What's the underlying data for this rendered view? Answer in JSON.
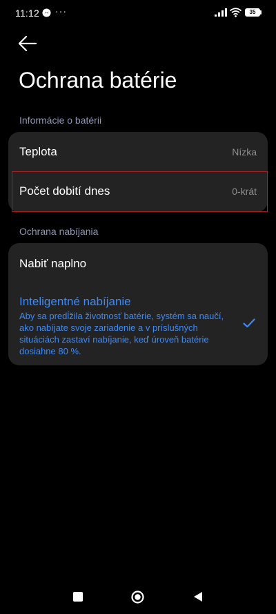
{
  "status_bar": {
    "time": "11:12",
    "more_indicator": "···",
    "battery_level": "35",
    "icons": [
      "messenger-icon",
      "signal-icon",
      "wifi-icon",
      "battery-icon"
    ]
  },
  "header": {
    "back_icon": "arrow-left-icon",
    "title": "Ochrana batérie"
  },
  "battery_info": {
    "section_title": "Informácie o batérii",
    "rows": [
      {
        "label": "Teplota",
        "value": "Nízka"
      },
      {
        "label": "Počet dobití dnes",
        "value": "0-krát"
      }
    ]
  },
  "charging_protection": {
    "section_title": "Ochrana nabíjania",
    "options": [
      {
        "label": "Nabiť naplno",
        "selected": false
      },
      {
        "label": "Inteligentné nabíjanie",
        "description": "Aby sa predĺžila životnosť batérie, systém sa naučí, ako nabíjate svoje zariadenie a v príslušných situáciách zastaví nabíjanie, keď úroveň batérie dosiahne 80 %.",
        "selected": true
      }
    ]
  },
  "colors": {
    "background": "#000000",
    "card": "#232323",
    "accent": "#3d8af7",
    "section_header": "#8e97b5",
    "highlight_border": "#b02020"
  },
  "nav_bar": {
    "icons": [
      "recents-square-icon",
      "home-circle-icon",
      "back-triangle-icon"
    ]
  }
}
